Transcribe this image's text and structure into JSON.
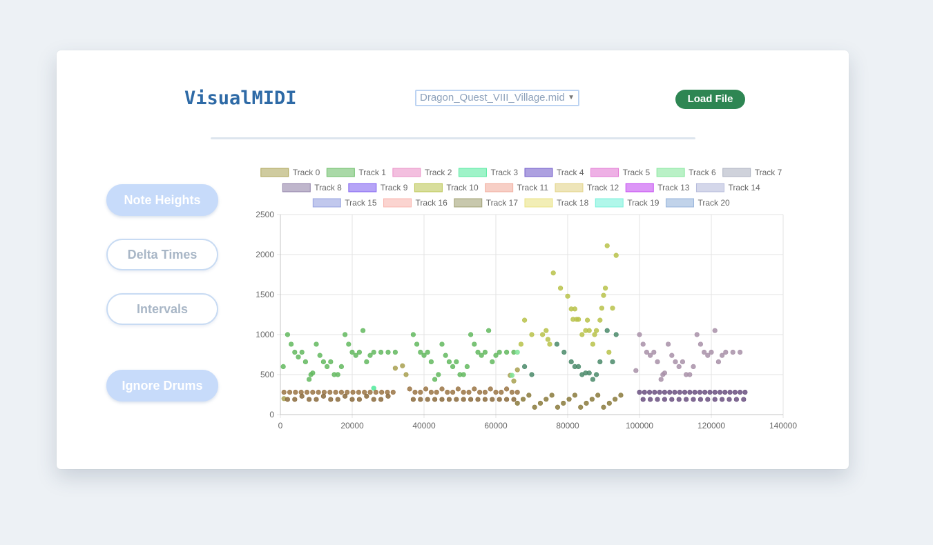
{
  "app": {
    "title": "VisualMIDI",
    "file_select": {
      "value": "Dragon_Quest_VIII_Village.mid"
    },
    "load_button": "Load File",
    "buttons": {
      "note_heights": "Note Heights",
      "delta_times": "Delta Times",
      "intervals": "Intervals",
      "ignore_drums": "Ignore Drums"
    },
    "colors": {
      "title": "#2e6aa6",
      "load_button": "#2e8653",
      "button_fill": "#c7dbfa",
      "button_border": "#c8dbf3"
    }
  },
  "chart_data": {
    "type": "scatter",
    "title": "",
    "xlabel": "",
    "ylabel": "",
    "xlim": [
      0,
      140000
    ],
    "ylim": [
      0,
      2500
    ],
    "x_ticks": [
      0,
      20000,
      40000,
      60000,
      80000,
      100000,
      120000,
      140000
    ],
    "y_ticks": [
      0,
      500,
      1000,
      1500,
      2000,
      2500
    ],
    "grid": true,
    "legend_position": "top",
    "series": [
      {
        "name": "Track 0",
        "color": "#a8a050",
        "points": [
          [
            1000,
            200
          ],
          [
            32000,
            580
          ],
          [
            34000,
            610
          ],
          [
            35000,
            500
          ],
          [
            65000,
            420
          ],
          [
            66000,
            560
          ],
          [
            64000,
            490
          ]
        ]
      },
      {
        "name": "Track 1",
        "color": "#63b95f",
        "points": [
          [
            800,
            600
          ],
          [
            2000,
            1000
          ],
          [
            3000,
            880
          ],
          [
            4000,
            780
          ],
          [
            5000,
            720
          ],
          [
            6000,
            780
          ],
          [
            7000,
            660
          ],
          [
            8000,
            440
          ],
          [
            8500,
            500
          ],
          [
            9000,
            520
          ],
          [
            10000,
            880
          ],
          [
            11000,
            740
          ],
          [
            12000,
            660
          ],
          [
            13000,
            600
          ],
          [
            14000,
            660
          ],
          [
            15000,
            500
          ],
          [
            16000,
            500
          ],
          [
            17000,
            600
          ],
          [
            18000,
            1000
          ],
          [
            19000,
            880
          ],
          [
            20000,
            780
          ],
          [
            21000,
            740
          ],
          [
            22000,
            780
          ],
          [
            23000,
            1050
          ],
          [
            24000,
            660
          ],
          [
            25000,
            740
          ],
          [
            26000,
            780
          ],
          [
            28000,
            780
          ],
          [
            30000,
            780
          ],
          [
            32000,
            780
          ],
          [
            37000,
            1000
          ],
          [
            38000,
            880
          ],
          [
            39000,
            780
          ],
          [
            40000,
            740
          ],
          [
            41000,
            780
          ],
          [
            42000,
            660
          ],
          [
            43000,
            440
          ],
          [
            44000,
            500
          ],
          [
            45000,
            880
          ],
          [
            46000,
            740
          ],
          [
            47000,
            660
          ],
          [
            48000,
            600
          ],
          [
            49000,
            660
          ],
          [
            50000,
            500
          ],
          [
            51000,
            500
          ],
          [
            52000,
            600
          ],
          [
            53000,
            1000
          ],
          [
            54000,
            880
          ],
          [
            55000,
            780
          ],
          [
            56000,
            740
          ],
          [
            57000,
            780
          ],
          [
            58000,
            1050
          ],
          [
            59000,
            660
          ],
          [
            60000,
            740
          ],
          [
            61000,
            780
          ],
          [
            63000,
            780
          ],
          [
            65000,
            780
          ]
        ]
      },
      {
        "name": "Track 2",
        "color": "#e98bc4",
        "points": []
      },
      {
        "name": "Track 3",
        "color": "#4ee99a",
        "points": [
          [
            26000,
            330
          ]
        ]
      },
      {
        "name": "Track 4",
        "color": "#6a52c6",
        "points": []
      },
      {
        "name": "Track 5",
        "color": "#e070d0",
        "points": []
      },
      {
        "name": "Track 6",
        "color": "#7fe598",
        "points": [
          [
            64500,
            490
          ],
          [
            66000,
            780
          ]
        ]
      },
      {
        "name": "Track 7",
        "color": "#a8adbe",
        "points": []
      },
      {
        "name": "Track 8",
        "color": "#8a7aa3",
        "points": []
      },
      {
        "name": "Track 9",
        "color": "#7a5af0",
        "points": []
      },
      {
        "name": "Track 10",
        "color": "#b8c24a",
        "points": [
          [
            67000,
            880
          ],
          [
            68000,
            1180
          ],
          [
            70000,
            1000
          ],
          [
            73000,
            1000
          ],
          [
            74000,
            1050
          ],
          [
            74500,
            940
          ],
          [
            75000,
            880
          ],
          [
            76000,
            1770
          ],
          [
            78000,
            1580
          ],
          [
            80000,
            1480
          ],
          [
            81000,
            1320
          ],
          [
            82000,
            1320
          ],
          [
            81500,
            1190
          ],
          [
            82500,
            1190
          ],
          [
            83000,
            1190
          ],
          [
            84000,
            1000
          ],
          [
            85000,
            1050
          ],
          [
            86000,
            1050
          ],
          [
            85500,
            1180
          ],
          [
            87000,
            880
          ],
          [
            88000,
            1050
          ],
          [
            87500,
            1000
          ],
          [
            89000,
            1180
          ],
          [
            89500,
            1330
          ],
          [
            90000,
            1490
          ],
          [
            90500,
            1580
          ],
          [
            91000,
            2110
          ],
          [
            91500,
            780
          ],
          [
            92500,
            1330
          ],
          [
            93500,
            1990
          ]
        ]
      },
      {
        "name": "Track 11",
        "color": "#f0a898",
        "points": []
      },
      {
        "name": "Track 12",
        "color": "#e0cf80",
        "points": []
      },
      {
        "name": "Track 13",
        "color": "#c040f0",
        "points": []
      },
      {
        "name": "Track 14",
        "color": "#b0b6d8",
        "points": []
      },
      {
        "name": "Track 15",
        "color": "#8e9ade",
        "points": []
      },
      {
        "name": "Track 16",
        "color": "#f7b0aa",
        "points": []
      },
      {
        "name": "Track 17",
        "color": "#9a9a6a",
        "points": []
      },
      {
        "name": "Track 18",
        "color": "#e8e07a",
        "points": []
      },
      {
        "name": "Track 19",
        "color": "#70f0d8",
        "points": []
      },
      {
        "name": "Track 20",
        "color": "#8eaed8",
        "points": []
      }
    ]
  }
}
